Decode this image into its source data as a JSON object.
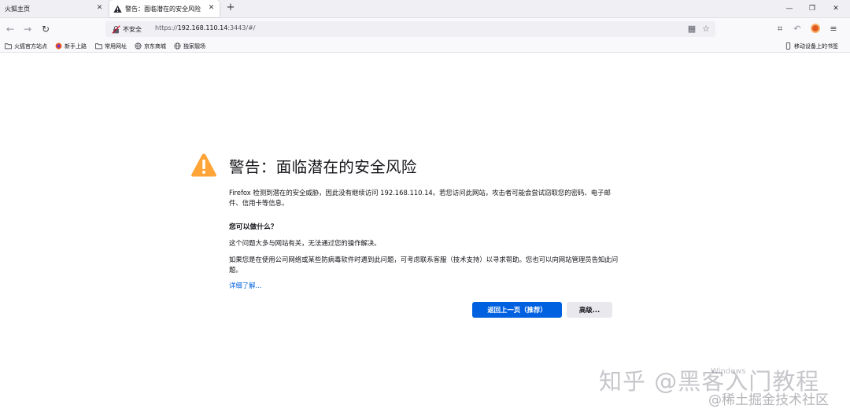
{
  "tabs": [
    {
      "label": "火狐主页",
      "active": false
    },
    {
      "label": "警告：面临潜在的安全风险",
      "active": true
    }
  ],
  "nav": {
    "security_label": "不安全",
    "url_scheme": "https://",
    "url_host": "192.168.110.14",
    "url_rest": ":3443/#/"
  },
  "bookmarks": [
    {
      "label": "火狐官方站点",
      "icon": "folder-icon"
    },
    {
      "label": "新手上路",
      "icon": "firefox-icon"
    },
    {
      "label": "常用网址",
      "icon": "folder-icon"
    },
    {
      "label": "京东商城",
      "icon": "globe-icon"
    },
    {
      "label": "独家靓场",
      "icon": "globe-icon"
    }
  ],
  "mobile_bookmarks": "移动设备上的书签",
  "page": {
    "title": "警告：面临潜在的安全风险",
    "intro": "Firefox 检测到潜在的安全威胁，因此没有继续访问 192.168.110.14。若您访问此网站，攻击者可能会尝试窃取您的密码、电子邮件、信用卡等信息。",
    "what_can_you_do": "您可以做什么？",
    "p1": "这个问题大多与网站有关，无法通过您的操作解决。",
    "p2": "如果您是在使用公司网络或某些防病毒软件时遇到此问题，可考虑联系客服（技术支持）以寻求帮助。您也可以向网站管理员告知此问题。",
    "learn_more": "详细了解...",
    "back_button": "返回上一页（推荐）",
    "advanced_button": "高级..."
  },
  "watermark": {
    "main": "知乎 @黑客入门教程",
    "windows": "Windows",
    "sub": "@稀土掘金技术社区"
  },
  "colors": {
    "accent": "#0061e0",
    "warning": "#ffa436"
  }
}
